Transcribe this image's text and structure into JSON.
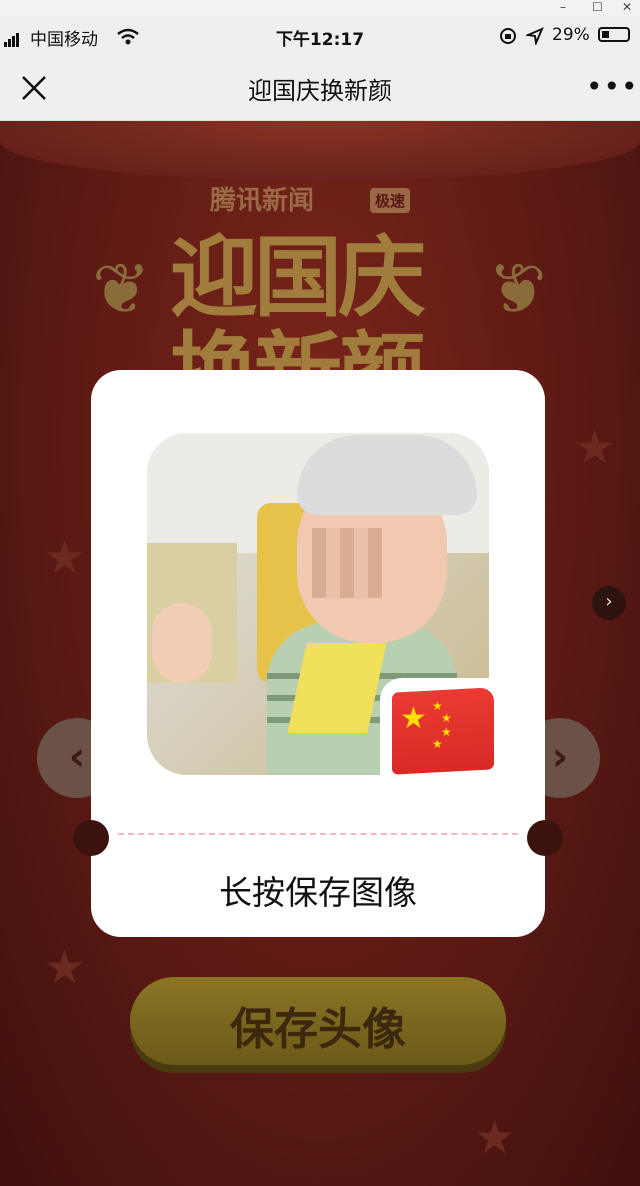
{
  "status_bar": {
    "carrier": "中国移动",
    "time": "下午12:17",
    "battery": "29%"
  },
  "nav": {
    "title": "迎国庆换新颜",
    "close_icon": "close-icon",
    "more_icon": "more-dots-icon",
    "more_symbol": "•••"
  },
  "background": {
    "brand": "腾讯新闻",
    "brand_badge": "极速",
    "hero_line1": "迎国庆",
    "hero_line2": "换新颜",
    "save_button": "保存头像"
  },
  "card": {
    "caption": "长按保存图像",
    "flag_icon": "china-flag-icon"
  },
  "colors": {
    "accent_red": "#d92a26",
    "page_bg": "#5a1612",
    "button_gold": "#8a7526"
  }
}
